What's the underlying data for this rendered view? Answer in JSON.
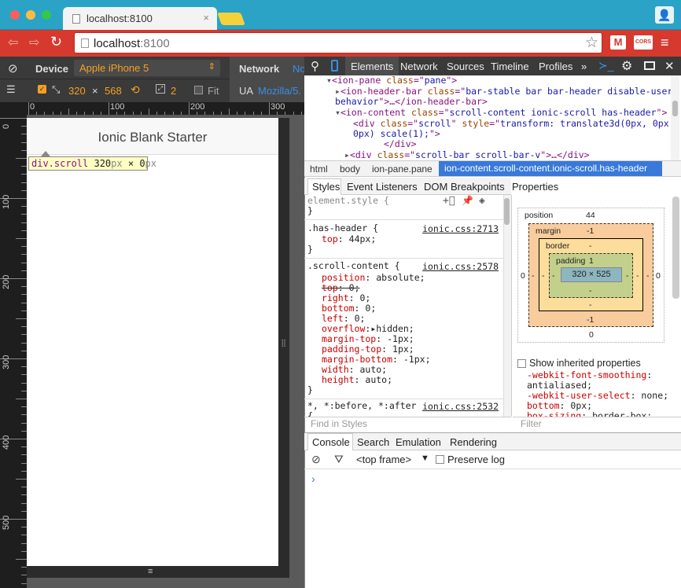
{
  "browser": {
    "tab_title": "localhost:8100",
    "url_host": "localhost",
    "url_port": ":8100",
    "tab_close": "×",
    "star": "☆",
    "gmail_label": "M",
    "cors_label": "CORS"
  },
  "device_bar": {
    "device_label": "Device",
    "device_value": "Apple iPhone 5",
    "network_label": "Network",
    "network_value": "No",
    "width": "320",
    "times": "×",
    "height": "568",
    "scale": "2",
    "fit_label": "Fit",
    "ua_label": "UA",
    "ua_value": "Mozilla/5."
  },
  "rulers": {
    "h_labels": [
      "0",
      "100",
      "200",
      "300"
    ],
    "v_labels": [
      "0",
      "100",
      "200",
      "300",
      "400",
      "500"
    ]
  },
  "app": {
    "header_title": "Ionic Blank Starter",
    "tooltip_sel": "div.scroll",
    "tooltip_w": "320",
    "tooltip_unit": "px",
    "tooltip_x": " × ",
    "tooltip_h": "0",
    "tooltip_unit2": "px"
  },
  "devtools": {
    "tabs": [
      "Elements",
      "Network",
      "Sources",
      "Timeline",
      "Profiles"
    ],
    "more": "»",
    "elements": [
      {
        "a": "<ion-pane ",
        "b": "class",
        "c": "=\"",
        "d": "pane",
        "e": "\">"
      },
      {
        "a": "<ion-header-bar ",
        "b": "class",
        "c": "=\"",
        "d": "bar-stable bar bar-header disable-user-",
        "e": ""
      },
      {
        "a": "",
        "b": "",
        "c": "",
        "d": "behavior",
        "e": "\">…</ion-header-bar>"
      },
      {
        "a": "<ion-content ",
        "b": "class",
        "c": "=\"",
        "d": "scroll-content ionic-scroll  has-header",
        "e": "\">"
      },
      {
        "a": "<div ",
        "b": "class",
        "c": "=\"",
        "d": "scroll",
        "e": "\" "
      },
      {
        "a": "",
        "b": "",
        "c": "",
        "d": "0px) scale(1);",
        "e": "\">"
      },
      {
        "a": "</div>",
        "b": "",
        "c": "",
        "d": "",
        "e": ""
      },
      {
        "a": "<div ",
        "b": "class",
        "c": "=\"",
        "d": "scroll-bar scroll-bar-v",
        "e": "\">…</div>"
      }
    ],
    "style_attr": "style",
    "style_val": "transform: translate3d(0px, 0px,",
    "breadcrumbs": [
      "html",
      "body",
      "ion-pane.pane"
    ],
    "breadcrumb_selected": "ion-content.scroll-content.ionic-scroll.has-header",
    "style_tabs": [
      "Styles",
      "Event Listeners",
      "DOM Breakpoints",
      "Properties"
    ],
    "element_style": "element.style {",
    "has_header": {
      "sel": ".has-header {",
      "src": "ionic.css:2713",
      "props": [
        {
          "p": "top",
          "v": "44px;"
        }
      ]
    },
    "scroll_content": {
      "sel": ".scroll-content {",
      "src": "ionic.css:2578",
      "props": [
        {
          "p": "position",
          "v": "absolute;"
        },
        {
          "p": "top",
          "v": "0;"
        },
        {
          "p": "right",
          "v": "0;"
        },
        {
          "p": "bottom",
          "v": "0;"
        },
        {
          "p": "left",
          "v": "0;"
        },
        {
          "p": "overflow",
          "v": "hidden;"
        },
        {
          "p": "margin-top",
          "v": "-1px;"
        },
        {
          "p": "padding-top",
          "v": "1px;"
        },
        {
          "p": "margin-bottom",
          "v": "-1px;"
        },
        {
          "p": "width",
          "v": "auto;"
        },
        {
          "p": "height",
          "v": "auto;"
        }
      ]
    },
    "universal": {
      "sel": "*, *:before, *:after",
      "src": "ionic.css:2532"
    },
    "close_brace": "}",
    "open_brace": "{",
    "find_styles": "Find in Styles",
    "filter": "Filter",
    "box_model": {
      "position_label": "position",
      "position_val": "44",
      "margin_label": "margin",
      "margin_top": "-1",
      "margin_bottom": "-1",
      "border_label": "border",
      "border_val": "-",
      "padding_label": "padding",
      "padding_top": "1",
      "padding_bottom": "-",
      "content": "320 × 525",
      "left": "0",
      "right": "0",
      "bottom": "0",
      "dash": "-"
    },
    "show_inherited": "Show inherited properties",
    "inherited": [
      {
        "p": "-webkit-font-smoothing",
        "v": ""
      },
      {
        "p": "",
        "v": "antialiased;"
      },
      {
        "p": "-webkit-user-select",
        "v": " none;"
      },
      {
        "p": "bottom",
        "v": " 0px;"
      },
      {
        "p": "box-sizing",
        "v": " border-box;"
      }
    ],
    "console_tabs": [
      "Console",
      "Search",
      "Emulation",
      "Rendering"
    ],
    "frame": "<top frame>",
    "preserve_log": "Preserve log",
    "prompt": "›"
  }
}
